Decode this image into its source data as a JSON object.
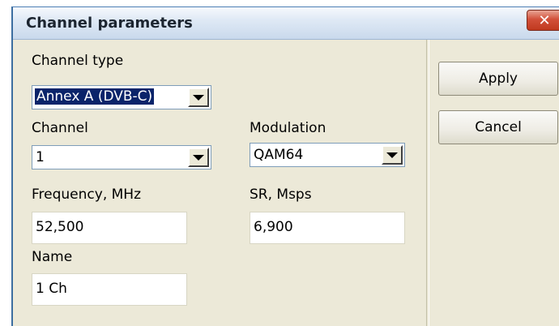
{
  "window": {
    "title": "Channel parameters",
    "close_glyph": "✕"
  },
  "channel_type": {
    "label": "Channel type",
    "value": "Annex A (DVB-C)"
  },
  "channel": {
    "label": "Channel",
    "value": "1"
  },
  "modulation": {
    "label": "Modulation",
    "value": "QAM64"
  },
  "frequency": {
    "label": "Frequency, MHz",
    "value": "52,500"
  },
  "symbol_rate": {
    "label": "SR, Msps",
    "value": "6,900"
  },
  "name": {
    "label": "Name",
    "value": "1 Ch"
  },
  "buttons": {
    "apply": "Apply",
    "cancel": "Cancel"
  },
  "icons": {
    "close": "close-icon",
    "dropdown": "chevron-down-icon"
  }
}
